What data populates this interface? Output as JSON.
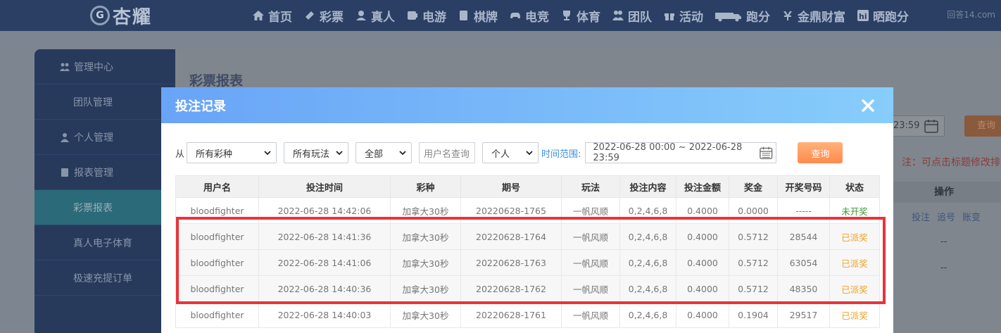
{
  "topbar": {
    "logo_text": "杏耀",
    "logo_mark": "G",
    "nav": [
      {
        "label": "首页",
        "icon": "home-icon"
      },
      {
        "label": "彩票",
        "icon": "lottery-icon"
      },
      {
        "label": "真人",
        "icon": "live-icon"
      },
      {
        "label": "电游",
        "icon": "slot-icon"
      },
      {
        "label": "棋牌",
        "icon": "cards-icon"
      },
      {
        "label": "电竞",
        "icon": "gamepad-icon"
      },
      {
        "label": "体育",
        "icon": "trophy-icon"
      },
      {
        "label": "团队",
        "icon": "team-icon"
      },
      {
        "label": "活动",
        "icon": "gift-icon"
      },
      {
        "label": "跑分",
        "icon": "truck-icon"
      },
      {
        "label": "金鼎财富",
        "icon": "money-icon"
      },
      {
        "label": "晒跑分",
        "icon": "hi-icon"
      }
    ],
    "watermark": "回答14.com"
  },
  "sidebar": {
    "items": [
      {
        "label": "管理中心",
        "type": "head",
        "icon": "users-icon"
      },
      {
        "label": "团队管理",
        "type": "sub"
      },
      {
        "label": "个人管理",
        "type": "head",
        "icon": "user-icon"
      },
      {
        "label": "报表管理",
        "type": "head",
        "icon": "report-icon"
      },
      {
        "label": "彩票报表",
        "type": "sub",
        "active": true
      },
      {
        "label": "真人电子体育",
        "type": "sub"
      },
      {
        "label": "极速充提订单",
        "type": "sub"
      }
    ]
  },
  "background": {
    "page_title": "彩票报表",
    "date_tail": "23:59",
    "query_label": "查询",
    "note": "注：可点击标题修改排",
    "ops_header": "操作",
    "actions": [
      "投注",
      "追号",
      "账变"
    ],
    "dash": "--"
  },
  "modal": {
    "title": "投注记录",
    "filters": {
      "from_label": "从",
      "lottery_select": "所有彩种",
      "play_select": "所有玩法",
      "scope_select": "全部",
      "username_placeholder": "用户名查询",
      "person_select": "个人",
      "range_label": "时间范围:",
      "date_range": "2022-06-28 00:00 ~ 2022-06-28 23:59",
      "query_label": "查询"
    },
    "table": {
      "headers": [
        "用户名",
        "投注时间",
        "彩种",
        "期号",
        "玩法",
        "投注内容",
        "投注金额",
        "奖金",
        "开奖号码",
        "状态"
      ],
      "rows": [
        [
          "bloodfighter",
          "2022-06-28 14:42:06",
          "加拿大30秒",
          "20220628-1765",
          "一帆风顺",
          "0,2,4,6,8",
          "0.4000",
          "0.0000",
          "-----",
          "未开奖"
        ],
        [
          "bloodfighter",
          "2022-06-28 14:41:36",
          "加拿大30秒",
          "20220628-1764",
          "一帆风顺",
          "0,2,4,6,8",
          "0.4000",
          "0.5712",
          "28544",
          "已派奖"
        ],
        [
          "bloodfighter",
          "2022-06-28 14:41:06",
          "加拿大30秒",
          "20220628-1763",
          "一帆风顺",
          "0,2,4,6,8",
          "0.4000",
          "0.5712",
          "63054",
          "已派奖"
        ],
        [
          "bloodfighter",
          "2022-06-28 14:40:36",
          "加拿大30秒",
          "20220628-1762",
          "一帆风顺",
          "0,2,4,6,8",
          "0.4000",
          "0.5712",
          "48350",
          "已派奖"
        ],
        [
          "bloodfighter",
          "2022-06-28 14:40:03",
          "加拿大30秒",
          "20220628-1761",
          "一帆风顺",
          "0,2,4,6,8",
          "0.4000",
          "0.1904",
          "29517",
          "已派奖"
        ]
      ]
    }
  },
  "colors": {
    "header_gradient_start": "#69a4f7",
    "header_gradient_end": "#87cdfb",
    "query_button": "#ff8a4c",
    "status_pending": "#3a9a34",
    "status_paid": "#f0a020",
    "highlight_border": "#e8343a"
  }
}
